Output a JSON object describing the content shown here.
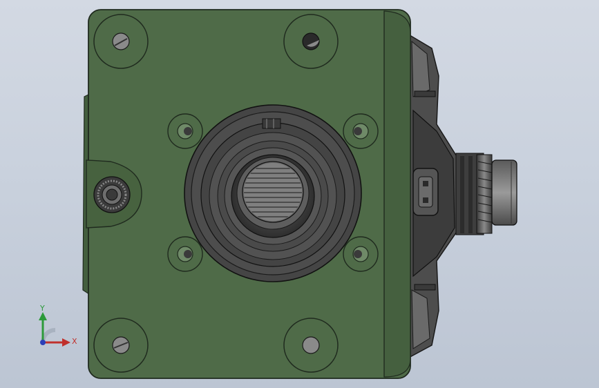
{
  "viewport": {
    "background_top": "#d3d9e3",
    "background_bottom": "#bcc5d3"
  },
  "part": {
    "body_color": "#4e6a48",
    "body_shadow": "#3f5a3b",
    "edge_color": "#1f2a1e",
    "metal_color": "#4a4a4a",
    "metal_light": "#7d7d7d"
  },
  "triad": {
    "x_label": "X",
    "y_label": "Y",
    "x_color": "#c0302c",
    "y_color": "#2c9a3a",
    "z_color": "#2b3fb8"
  }
}
